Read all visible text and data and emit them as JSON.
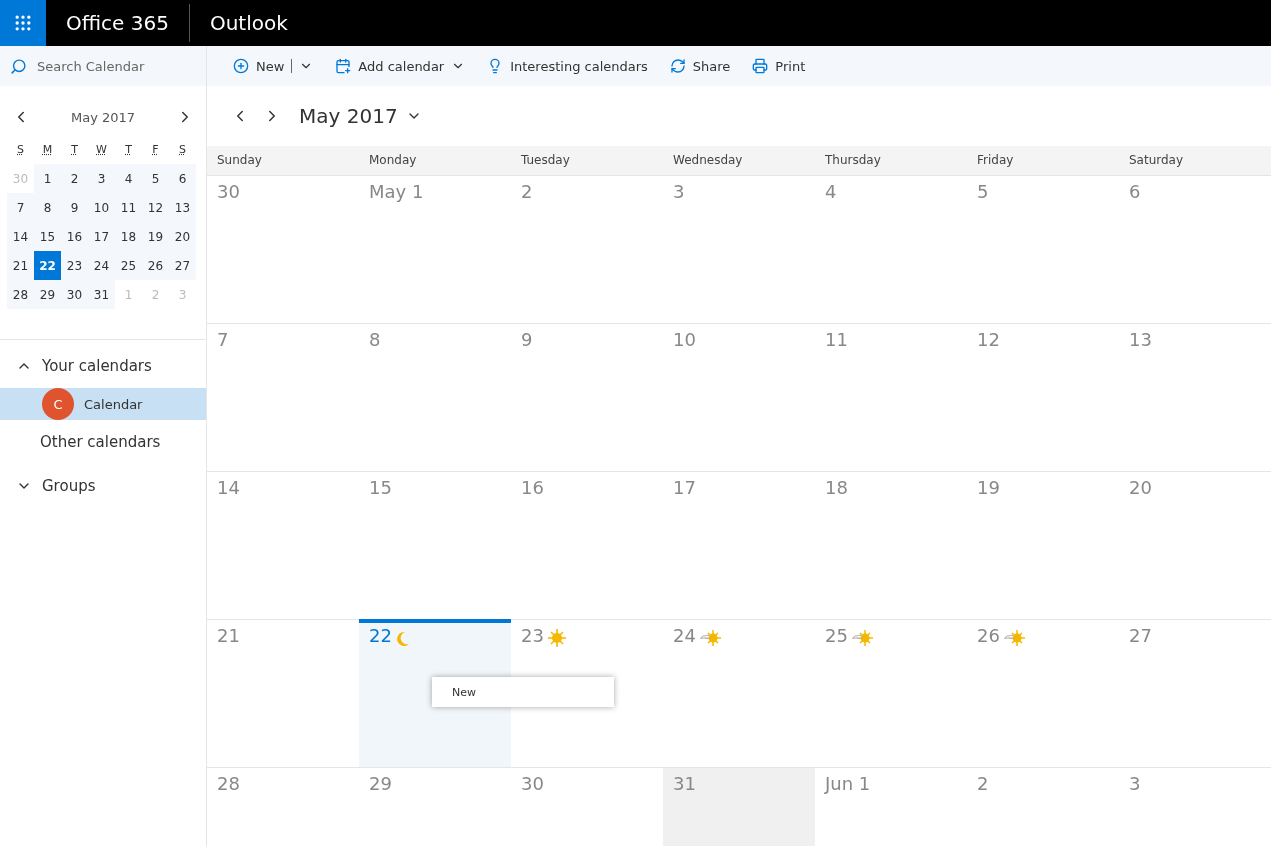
{
  "top_bar": {
    "suite": "Office 365",
    "app": "Outlook"
  },
  "search": {
    "placeholder": "Search Calendar"
  },
  "toolbar": [
    {
      "label": "New",
      "dropdown": true,
      "split": true
    },
    {
      "label": "Add calendar",
      "dropdown": true,
      "split": false
    },
    {
      "label": "Interesting calendars",
      "dropdown": false,
      "split": false
    },
    {
      "label": "Share",
      "dropdown": false,
      "split": false
    },
    {
      "label": "Print",
      "dropdown": false,
      "split": false
    }
  ],
  "mini_calendar": {
    "title": "May 2017",
    "weekdays": [
      "S",
      "M",
      "T",
      "W",
      "T",
      "F",
      "S"
    ],
    "weeks": [
      [
        {
          "label": "30",
          "outside": true,
          "selected": false
        },
        {
          "label": "1",
          "outside": false,
          "selected": false
        },
        {
          "label": "2",
          "outside": false,
          "selected": false
        },
        {
          "label": "3",
          "outside": false,
          "selected": false
        },
        {
          "label": "4",
          "outside": false,
          "selected": false
        },
        {
          "label": "5",
          "outside": false,
          "selected": false
        },
        {
          "label": "6",
          "outside": false,
          "selected": false
        }
      ],
      [
        {
          "label": "7",
          "outside": false,
          "selected": false
        },
        {
          "label": "8",
          "outside": false,
          "selected": false
        },
        {
          "label": "9",
          "outside": false,
          "selected": false
        },
        {
          "label": "10",
          "outside": false,
          "selected": false
        },
        {
          "label": "11",
          "outside": false,
          "selected": false
        },
        {
          "label": "12",
          "outside": false,
          "selected": false
        },
        {
          "label": "13",
          "outside": false,
          "selected": false
        }
      ],
      [
        {
          "label": "14",
          "outside": false,
          "selected": false
        },
        {
          "label": "15",
          "outside": false,
          "selected": false
        },
        {
          "label": "16",
          "outside": false,
          "selected": false
        },
        {
          "label": "17",
          "outside": false,
          "selected": false
        },
        {
          "label": "18",
          "outside": false,
          "selected": false
        },
        {
          "label": "19",
          "outside": false,
          "selected": false
        },
        {
          "label": "20",
          "outside": false,
          "selected": false
        }
      ],
      [
        {
          "label": "21",
          "outside": false,
          "selected": false
        },
        {
          "label": "22",
          "outside": false,
          "selected": true
        },
        {
          "label": "23",
          "outside": false,
          "selected": false
        },
        {
          "label": "24",
          "outside": false,
          "selected": false
        },
        {
          "label": "25",
          "outside": false,
          "selected": false
        },
        {
          "label": "26",
          "outside": false,
          "selected": false
        },
        {
          "label": "27",
          "outside": false,
          "selected": false
        }
      ],
      [
        {
          "label": "28",
          "outside": false,
          "selected": false
        },
        {
          "label": "29",
          "outside": false,
          "selected": false
        },
        {
          "label": "30",
          "outside": false,
          "selected": false
        },
        {
          "label": "31",
          "outside": false,
          "selected": false
        },
        {
          "label": "1",
          "outside": true,
          "selected": false
        },
        {
          "label": "2",
          "outside": true,
          "selected": false
        },
        {
          "label": "3",
          "outside": true,
          "selected": false
        }
      ]
    ]
  },
  "calendar_groups": [
    {
      "label": "Your calendars",
      "expanded": true,
      "items": [
        {
          "label": "Calendar",
          "initial": "C",
          "color": "#e0532f",
          "selected": true
        }
      ]
    },
    {
      "label": "Other calendars"
    },
    {
      "label": "Groups",
      "expanded": false
    }
  ],
  "month_title": "May 2017",
  "weekdays": [
    "Sunday",
    "Monday",
    "Tuesday",
    "Wednesday",
    "Thursday",
    "Friday",
    "Saturday"
  ],
  "weeks": [
    [
      {
        "label": "30",
        "today": false,
        "hovered": false
      },
      {
        "label": "May 1",
        "today": false,
        "hovered": false
      },
      {
        "label": "2",
        "today": false,
        "hovered": false
      },
      {
        "label": "3",
        "today": false,
        "hovered": false
      },
      {
        "label": "4",
        "today": false,
        "hovered": false
      },
      {
        "label": "5",
        "today": false,
        "hovered": false
      },
      {
        "label": "6",
        "today": false,
        "hovered": false
      }
    ],
    [
      {
        "label": "7",
        "today": false,
        "hovered": false
      },
      {
        "label": "8",
        "today": false,
        "hovered": false
      },
      {
        "label": "9",
        "today": false,
        "hovered": false
      },
      {
        "label": "10",
        "today": false,
        "hovered": false
      },
      {
        "label": "11",
        "today": false,
        "hovered": false
      },
      {
        "label": "12",
        "today": false,
        "hovered": false
      },
      {
        "label": "13",
        "today": false,
        "hovered": false
      }
    ],
    [
      {
        "label": "14",
        "today": false,
        "hovered": false
      },
      {
        "label": "15",
        "today": false,
        "hovered": false
      },
      {
        "label": "16",
        "today": false,
        "hovered": false
      },
      {
        "label": "17",
        "today": false,
        "hovered": false
      },
      {
        "label": "18",
        "today": false,
        "hovered": false
      },
      {
        "label": "19",
        "today": false,
        "hovered": false
      },
      {
        "label": "20",
        "today": false,
        "hovered": false
      }
    ],
    [
      {
        "label": "21",
        "today": false,
        "hovered": false
      },
      {
        "label": "22",
        "weather": {
          "kind": "moon"
        },
        "today": true,
        "hovered": false,
        "menu": [
          "New"
        ]
      },
      {
        "label": "23",
        "weather": {
          "kind": "sun"
        },
        "today": false,
        "hovered": false
      },
      {
        "label": "24",
        "weather": {
          "kind": "cloud-sun"
        },
        "today": false,
        "hovered": false
      },
      {
        "label": "25",
        "weather": {
          "kind": "cloud-sun"
        },
        "today": false,
        "hovered": false
      },
      {
        "label": "26",
        "weather": {
          "kind": "cloud-sun"
        },
        "today": false,
        "hovered": false
      },
      {
        "label": "27",
        "today": false,
        "hovered": false
      }
    ],
    [
      {
        "label": "28",
        "today": false,
        "hovered": false
      },
      {
        "label": "29",
        "today": false,
        "hovered": false
      },
      {
        "label": "30",
        "today": false,
        "hovered": false
      },
      {
        "label": "31",
        "today": false,
        "hovered": true
      },
      {
        "label": "Jun 1",
        "today": false,
        "hovered": false
      },
      {
        "label": "2",
        "today": false,
        "hovered": false
      },
      {
        "label": "3",
        "today": false,
        "hovered": false
      }
    ]
  ]
}
